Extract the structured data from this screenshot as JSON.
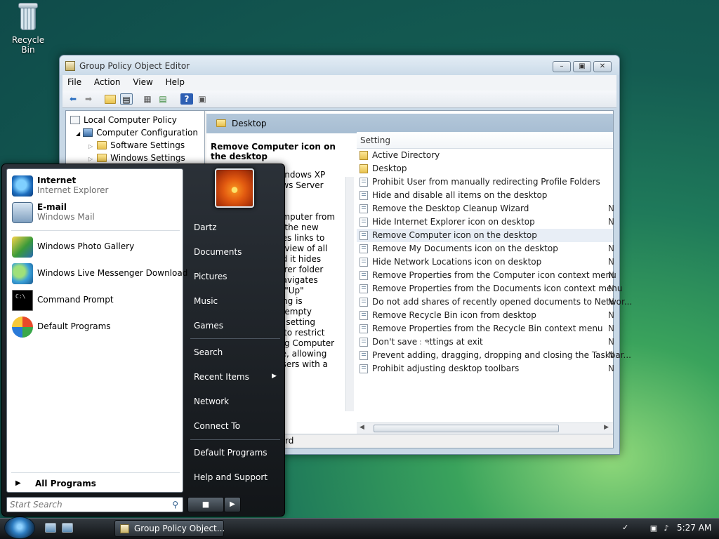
{
  "desktop": {
    "recycle_bin_label": "Recycle Bin"
  },
  "window": {
    "title": "Group Policy Object Editor",
    "menu": [
      "File",
      "Action",
      "View",
      "Help"
    ],
    "tree": {
      "root": "Local Computer Policy",
      "computer_config": "Computer Configuration",
      "software_settings": "Software Settings",
      "windows_settings": "Windows Settings"
    },
    "header": "Desktop",
    "description": {
      "title": "Remove Computer icon on the desktop",
      "fragments": [
        "Vindows XP",
        "ows Server",
        "",
        "",
        "omputer from",
        "n the new",
        "des links to",
        "b view of all",
        "nd it hides",
        "lorer folder",
        "navigates",
        "e \"Up\"",
        "ting is",
        "n empty",
        "is setting",
        "s to restrict",
        "ing Computer",
        "ce, allowing",
        "users with a"
      ]
    },
    "list_header": "Setting",
    "settings": [
      {
        "label": "Active Directory",
        "folder": true,
        "tail": ""
      },
      {
        "label": "Desktop",
        "folder": true,
        "tail": ""
      },
      {
        "label": "Prohibit User from manually redirecting Profile Folders",
        "folder": false,
        "tail": ""
      },
      {
        "label": "Hide and disable all items on the desktop",
        "folder": false,
        "tail": ""
      },
      {
        "label": "Remove the Desktop Cleanup Wizard",
        "folder": false,
        "tail": "N"
      },
      {
        "label": "Hide Internet Explorer icon on desktop",
        "folder": false,
        "tail": "N"
      },
      {
        "label": "Remove Computer icon on the desktop",
        "folder": false,
        "tail": "",
        "selected": true
      },
      {
        "label": "Remove My Documents icon on the desktop",
        "folder": false,
        "tail": "N"
      },
      {
        "label": "Hide Network Locations icon on desktop",
        "folder": false,
        "tail": "N"
      },
      {
        "label": "Remove Properties from the Computer icon context menu",
        "folder": false,
        "tail": "N"
      },
      {
        "label": "Remove Properties from the Documents icon context menu",
        "folder": false,
        "tail": "N"
      },
      {
        "label": "Do not add shares of recently opened documents to Networ...",
        "folder": false,
        "tail": "N"
      },
      {
        "label": "Remove Recycle Bin icon from desktop",
        "folder": false,
        "tail": "N"
      },
      {
        "label": "Remove Properties from the Recycle Bin context menu",
        "folder": false,
        "tail": "N"
      },
      {
        "label": "Don't save settings at exit",
        "folder": false,
        "tail": "N"
      },
      {
        "label": "Prevent adding, dragging, dropping and closing the Taskbar...",
        "folder": false,
        "tail": "N"
      },
      {
        "label": "Prohibit adjusting desktop toolbars",
        "folder": false,
        "tail": "N"
      }
    ],
    "tab_fragment": "rd"
  },
  "start_menu": {
    "pinned": [
      {
        "title": "Internet",
        "subtitle": "Internet Explorer"
      },
      {
        "title": "E-mail",
        "subtitle": "Windows Mail"
      }
    ],
    "recent": [
      "Windows Photo Gallery",
      "Windows Live Messenger Download",
      "Command Prompt",
      "Default Programs"
    ],
    "all_programs": "All Programs",
    "search_placeholder": "Start Search",
    "right": {
      "user": "Dartz",
      "documents": "Documents",
      "pictures": "Pictures",
      "music": "Music",
      "games": "Games",
      "search": "Search",
      "recent_items": "Recent Items",
      "network": "Network",
      "connect_to": "Connect To",
      "default_programs": "Default Programs",
      "help_support": "Help and Support"
    }
  },
  "taskbar": {
    "task_button": "Group Policy Object...",
    "clock": "5:27 AM"
  }
}
